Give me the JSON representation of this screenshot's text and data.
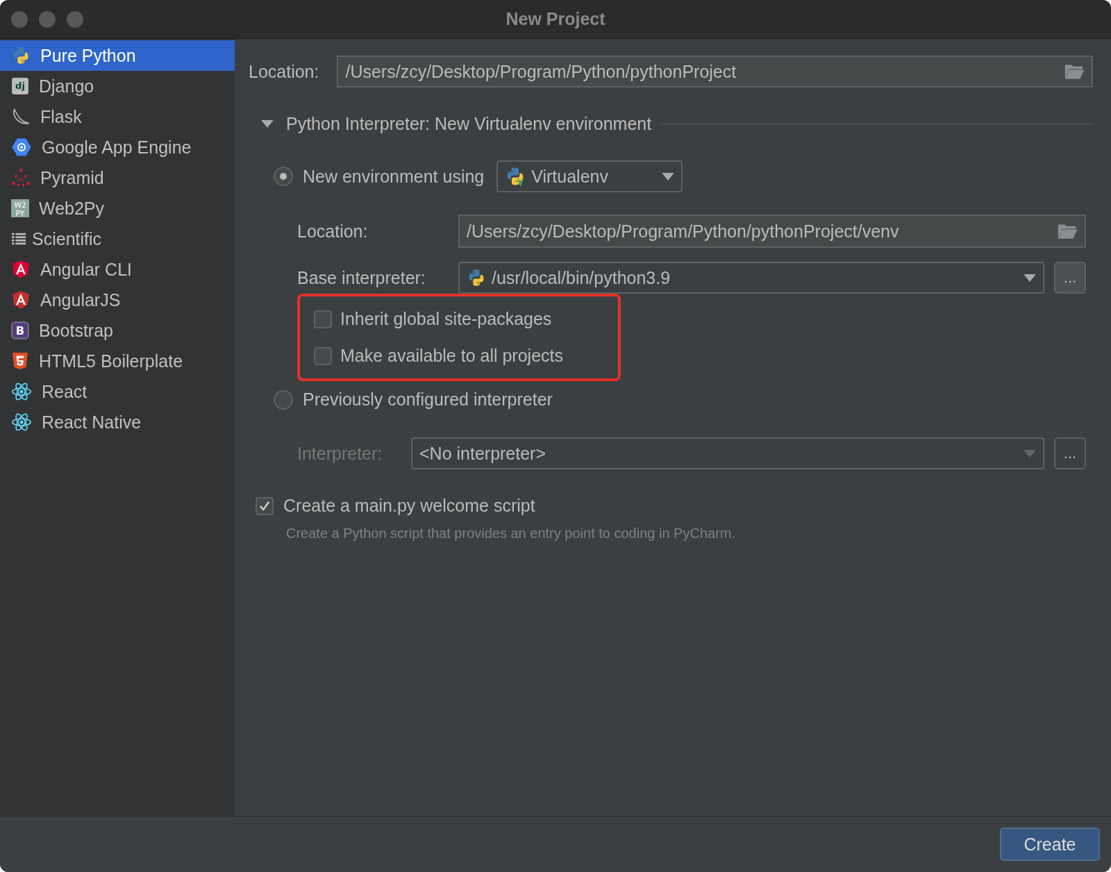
{
  "window": {
    "title": "New Project"
  },
  "sidebar": {
    "items": [
      {
        "label": "Pure Python",
        "selected": true
      },
      {
        "label": "Django",
        "selected": false,
        "icon_text": [
          "dj"
        ]
      },
      {
        "label": "Flask",
        "selected": false
      },
      {
        "label": "Google App Engine",
        "selected": false
      },
      {
        "label": "Pyramid",
        "selected": false
      },
      {
        "label": "Web2Py",
        "selected": false,
        "icon_text": [
          "W2",
          "PY"
        ]
      },
      {
        "label": "Scientific",
        "selected": false
      },
      {
        "label": "Angular CLI",
        "selected": false
      },
      {
        "label": "AngularJS",
        "selected": false
      },
      {
        "label": "Bootstrap",
        "selected": false,
        "icon_text": [
          "B"
        ]
      },
      {
        "label": "HTML5 Boilerplate",
        "selected": false
      },
      {
        "label": "React",
        "selected": false
      },
      {
        "label": "React Native",
        "selected": false
      }
    ]
  },
  "location": {
    "label": "Location:",
    "value": "/Users/zcy/Desktop/Program/Python/pythonProject"
  },
  "interpreter_section": {
    "title": "Python Interpreter: New Virtualenv environment",
    "expanded": true,
    "new_env": {
      "label": "New environment using",
      "selected": true,
      "tool": "Virtualenv",
      "location": {
        "label": "Location:",
        "value": "/Users/zcy/Desktop/Program/Python/pythonProject/venv"
      },
      "base": {
        "label": "Base interpreter:",
        "value": "/usr/local/bin/python3.9",
        "browse": "..."
      },
      "options": [
        {
          "label": "Inherit global site-packages",
          "checked": false
        },
        {
          "label": "Make available to all projects",
          "checked": false
        }
      ]
    },
    "previous": {
      "label": "Previously configured interpreter",
      "selected": false,
      "interpreter": {
        "label": "Interpreter:",
        "value": "<No interpreter>",
        "disabled": true,
        "browse": "..."
      }
    }
  },
  "welcome": {
    "label": "Create a main.py welcome script",
    "checked": true,
    "hint": "Create a Python script that provides an entry point to coding in PyCharm."
  },
  "buttons": [
    {
      "label": "Create"
    }
  ]
}
